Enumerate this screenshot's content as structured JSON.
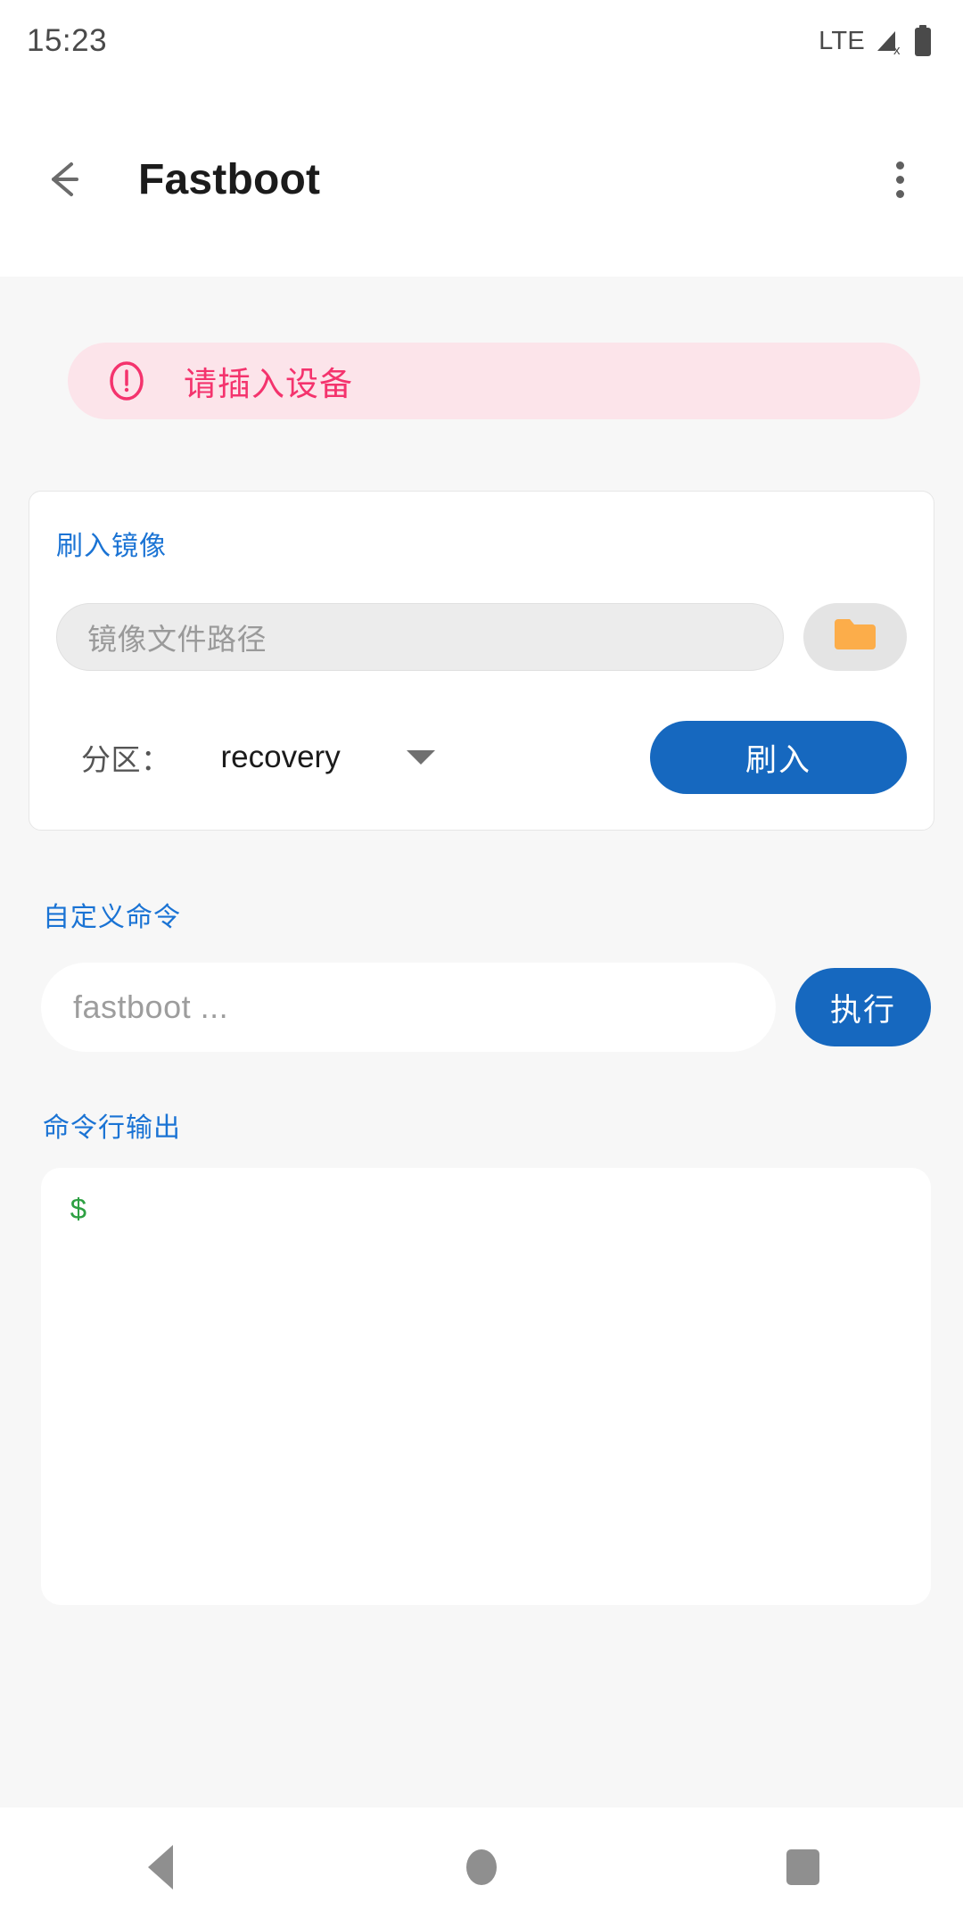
{
  "status_bar": {
    "time": "15:23",
    "network_label": "LTE",
    "signal_icon": "signal-no-data-icon",
    "battery_icon": "battery-full-icon"
  },
  "toolbar": {
    "back_icon": "arrow-back-icon",
    "title": "Fastboot",
    "overflow_icon": "more-vert-icon"
  },
  "alert": {
    "icon": "error-outline-icon",
    "message": "请插入设备",
    "bg_color": "#fce4ea",
    "text_color": "#f4336d"
  },
  "flash_card": {
    "label": "刷入镜像",
    "path_input": {
      "value": "",
      "placeholder": "镜像文件路径"
    },
    "browse_icon": "folder-icon",
    "browse_icon_color": "#fcad4a",
    "partition_label": "分区：",
    "partition_value": "recovery",
    "partition_options": [
      "recovery"
    ],
    "dropdown_icon": "chevron-down-icon",
    "flash_button": "刷入",
    "accent_color": "#1668bf"
  },
  "custom_command": {
    "label": "自定义命令",
    "input": {
      "value": "",
      "placeholder": "fastboot ..."
    },
    "execute_button": "执行"
  },
  "output": {
    "label": "命令行输出",
    "lines": [
      "$"
    ],
    "prompt_color": "#2ea043"
  },
  "nav_bar": {
    "back_icon": "nav-back-triangle-icon",
    "home_icon": "nav-home-circle-icon",
    "recents_icon": "nav-recents-square-icon"
  }
}
